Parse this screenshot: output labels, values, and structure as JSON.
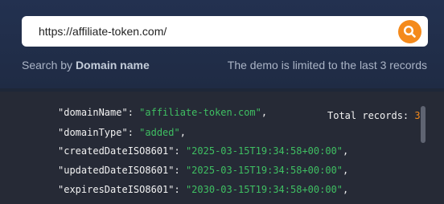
{
  "search": {
    "value": "https://affiliate-token.com/",
    "hint_prefix": "Search by ",
    "hint_bold": "Domain name",
    "limit_notice": "The demo is limited to the last 3 records"
  },
  "results": {
    "total_label": "Total records: ",
    "total_count": "3",
    "lines": [
      {
        "key": "\"domainName\": ",
        "value": "\"affiliate-token.com\"",
        "tail": ","
      },
      {
        "key": "\"domainType\": ",
        "value": "\"added\"",
        "tail": ","
      },
      {
        "key": "\"createdDateISO8601\": ",
        "value": "\"2025-03-15T19:34:58+00:00\"",
        "tail": ","
      },
      {
        "key": "\"updatedDateISO8601\": ",
        "value": "\"2025-03-15T19:34:58+00:00\"",
        "tail": ","
      },
      {
        "key": "\"expiresDateISO8601\": ",
        "value": "\"2030-03-15T19:34:58+00:00\"",
        "tail": ","
      }
    ]
  },
  "icons": {
    "search_button": "search-icon"
  },
  "colors": {
    "accent": "#f48a1c",
    "string_value": "#3fbf62",
    "code_bg": "#262a36",
    "panel_bg": "#233150"
  }
}
